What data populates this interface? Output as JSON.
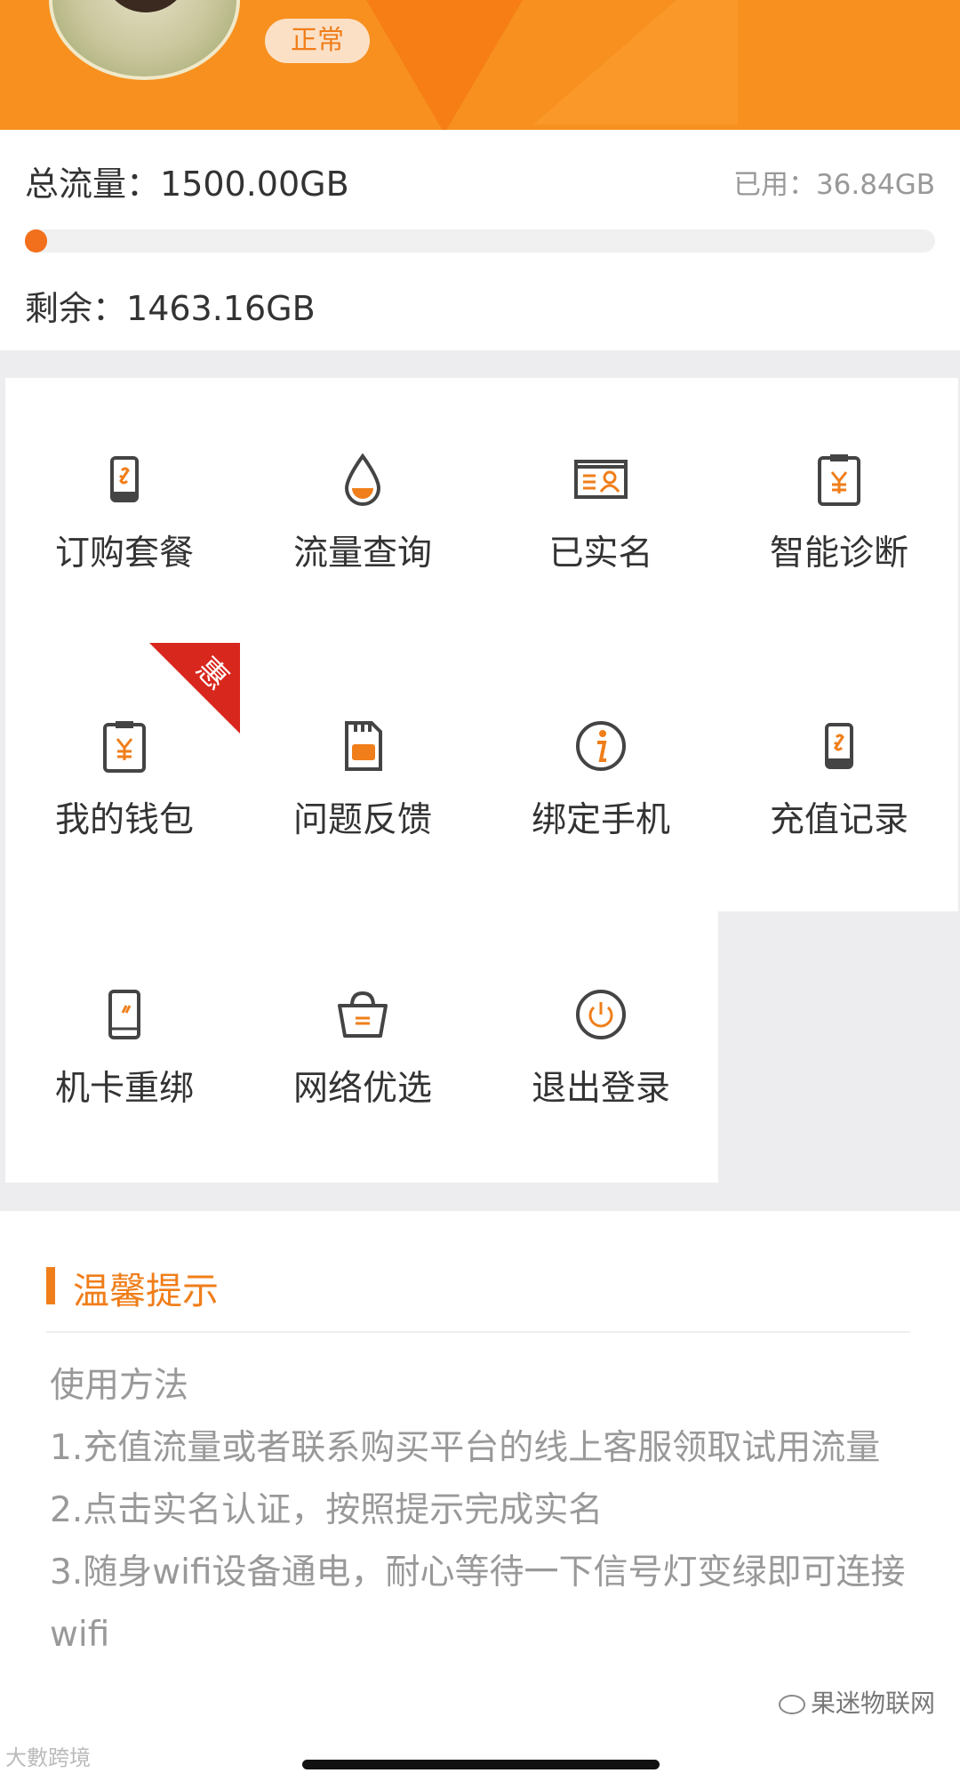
{
  "header": {
    "status_badge": "正常",
    "avatar_icon": "avatar-image"
  },
  "traffic": {
    "total_label": "总流量：",
    "total_value": "1500.00GB",
    "used_label": "已用：",
    "used_value": "36.84GB",
    "remain_label": "剩余：",
    "remain_value": "1463.16GB",
    "used_percent": 2.46,
    "bar_color": "#f26f1c"
  },
  "menu": [
    {
      "label": "订购套餐",
      "icon": "phone-link-icon"
    },
    {
      "label": "流量查询",
      "icon": "water-drop-icon"
    },
    {
      "label": "已实名",
      "icon": "id-card-icon"
    },
    {
      "label": "智能诊断",
      "icon": "clipboard-yuan-icon"
    },
    {
      "label": "我的钱包",
      "icon": "clipboard-yuan-icon",
      "badge": "惠"
    },
    {
      "label": "问题反馈",
      "icon": "sim-card-icon"
    },
    {
      "label": "绑定手机",
      "icon": "info-icon"
    },
    {
      "label": "充值记录",
      "icon": "phone-link-icon"
    },
    {
      "label": "机卡重绑",
      "icon": "phone-slash-icon"
    },
    {
      "label": "网络优选",
      "icon": "basket-icon"
    },
    {
      "label": "退出登录",
      "icon": "power-icon"
    }
  ],
  "tips": {
    "title": "温馨提示",
    "lines": [
      "使用方法",
      "1.充值流量或者联系购买平台的线上客服领取试用流量",
      "2.点击实名认证，按照提示完成实名",
      "3.随身wifi设备通电，耐心等待一下信号灯变绿即可连接wifi"
    ]
  },
  "watermarks": {
    "left": "大數跨境",
    "right": "果迷物联网"
  },
  "colors": {
    "accent": "#f07e1a",
    "header": "#f7901e",
    "promo": "#d8271d"
  }
}
